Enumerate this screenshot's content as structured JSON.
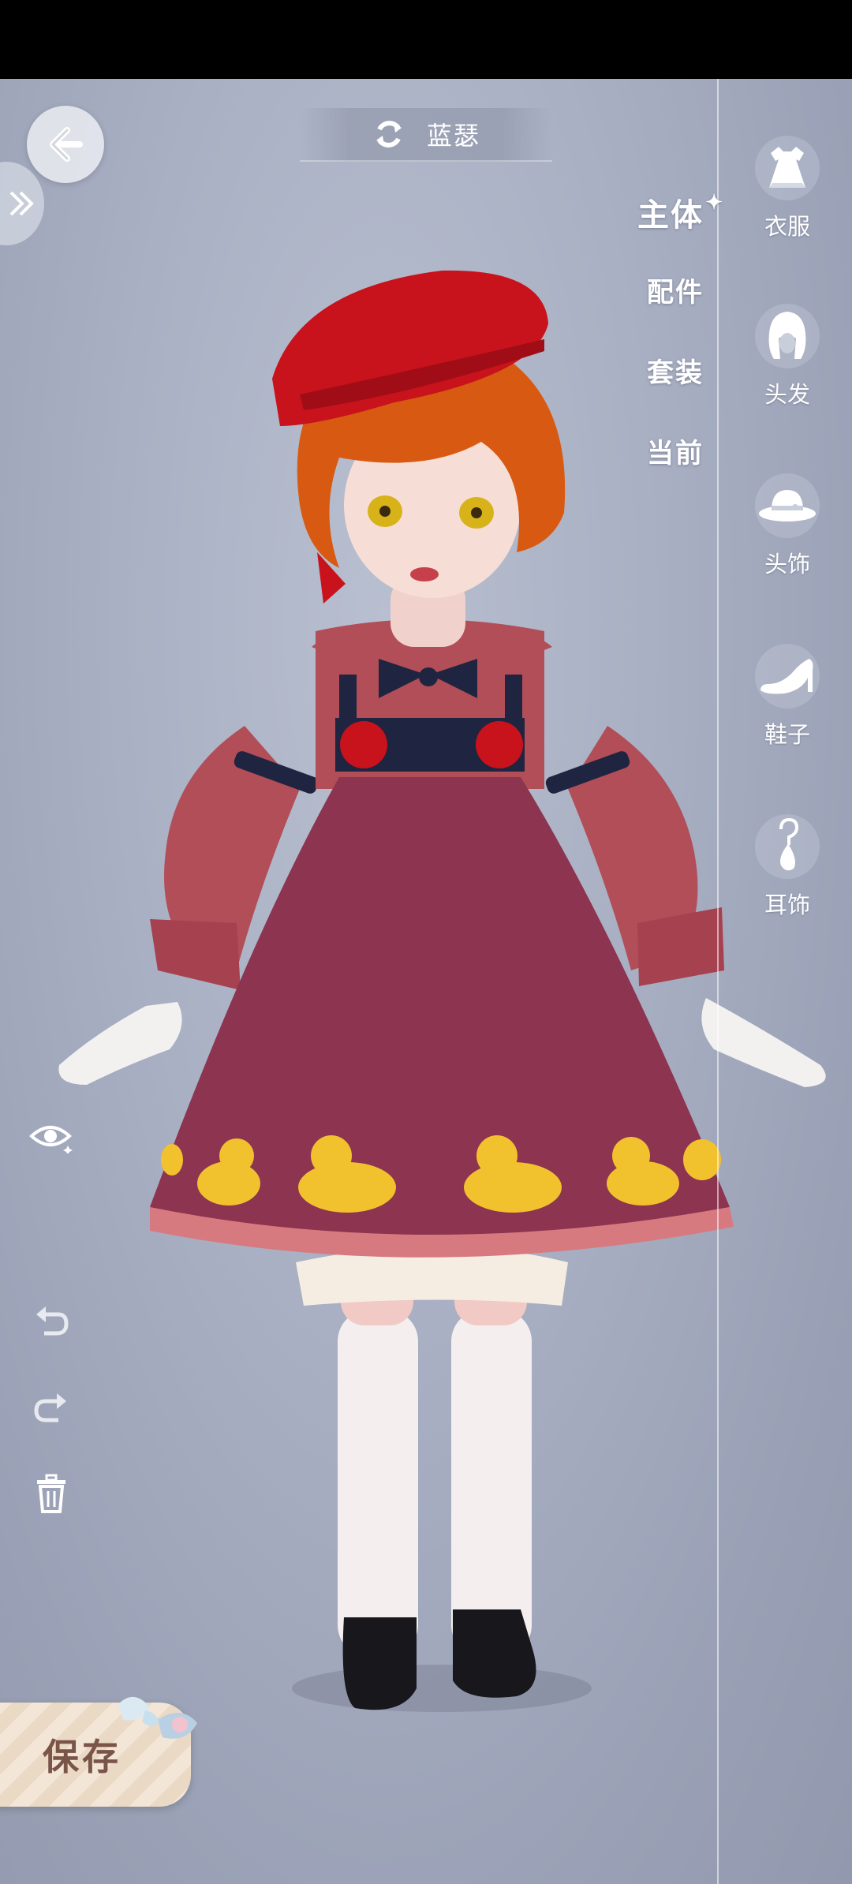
{
  "header": {
    "title": "蓝瑟"
  },
  "mid_tabs": [
    {
      "label": "主体",
      "active": true
    },
    {
      "label": "配件",
      "active": false
    },
    {
      "label": "套装",
      "active": false
    },
    {
      "label": "当前",
      "active": false
    }
  ],
  "categories": [
    {
      "label": "衣服",
      "icon": "dress-icon"
    },
    {
      "label": "头发",
      "icon": "hair-icon"
    },
    {
      "label": "头饰",
      "icon": "hat-icon"
    },
    {
      "label": "鞋子",
      "icon": "high-heel-icon"
    },
    {
      "label": "耳饰",
      "icon": "earring-icon"
    }
  ],
  "tools": [
    "eye-icon",
    "undo-icon",
    "redo-icon",
    "trash-icon"
  ],
  "save": {
    "label": "保存"
  },
  "colors": {
    "background": "#a9b0c3",
    "dress": "#8c3450",
    "sleeves": "#b14e58",
    "hair": "#d85a12",
    "beret": "#c8121c",
    "duck": "#f2c12e",
    "save_text": "#7a5448"
  }
}
